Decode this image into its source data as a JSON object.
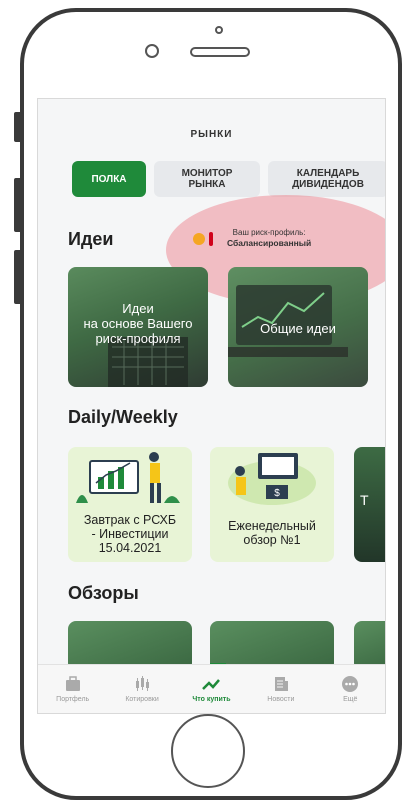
{
  "header": {
    "title": "РЫНКИ"
  },
  "tabs": [
    {
      "label": "ПОЛКА"
    },
    {
      "label": "МОНИТОР\nРЫНКА"
    },
    {
      "label": "КАЛЕНДАРЬ\nДИВИДЕНДОВ"
    }
  ],
  "ideas": {
    "title": "Идеи",
    "risk_label": "Ваш риск-профиль:",
    "risk_value": "Сбалансированный",
    "cards": [
      {
        "label": "Идеи\nна основе Вашего\nриск-профиля"
      },
      {
        "label": "Общие идеи"
      }
    ]
  },
  "daily": {
    "title": "Daily/Weekly",
    "cards": [
      {
        "label": "Завтрак с РСХБ\n- Инвестиции\n15.04.2021"
      },
      {
        "label": "Еженедельный\nобзор №1"
      },
      {
        "label": "Т"
      }
    ]
  },
  "reviews": {
    "title": "Обзоры"
  },
  "nav": [
    {
      "label": "Портфель",
      "icon": "briefcase-icon"
    },
    {
      "label": "Котировки",
      "icon": "candlestick-icon"
    },
    {
      "label": "Что купить",
      "icon": "trend-icon"
    },
    {
      "label": "Новости",
      "icon": "news-icon"
    },
    {
      "label": "Ещё",
      "icon": "more-icon"
    }
  ],
  "colors": {
    "accent": "#1f8a3a",
    "highlight": "#ee7882"
  }
}
